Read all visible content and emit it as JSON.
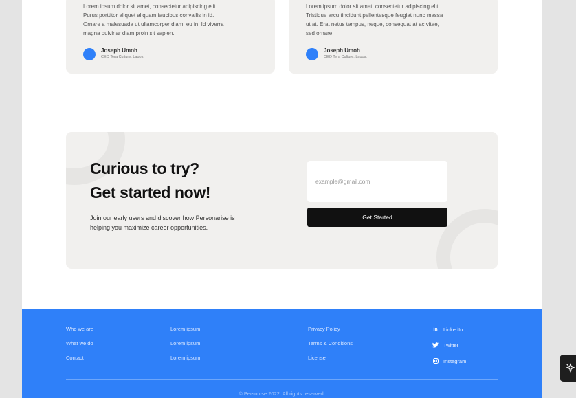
{
  "testimonials": [
    {
      "lines": [
        "Lorem ipsum dolor sit amet, consectetur adipiscing elit.",
        "Purus porttitor aliquet aliquam faucibus convallis in id.",
        "Ornare a malesuada ut ullamcorper diam, eu in. Id viverra",
        "magna pulvinar diam proin sit sapien."
      ],
      "name": "Joseph Umoh",
      "role": "CEO Tera Culture, Lagos."
    },
    {
      "lines": [
        "Lorem ipsum dolor sit amet, consectetur adipiscing elit.",
        "Tristique arcu tincidunt pellentesque feugiat nunc massa",
        "ut at. Erat netus tempus, neque, consequat at ac vitae,",
        "sed ornare."
      ],
      "name": "Joseph Umoh",
      "role": "CEO Tera Culture, Lagos."
    }
  ],
  "cta": {
    "heading_line1": "Curious to try?",
    "heading_line2": "Get started now!",
    "description_line1": "Join our early users and discover how Personarise is",
    "description_line2": "helping you maximize career opportunities.",
    "email_placeholder": "example@gmail.com",
    "button_label": "Get Started"
  },
  "footer": {
    "col1": [
      "Who we are",
      "What we do",
      "Contact"
    ],
    "col2": [
      "Lorem ipsum",
      "Lorem ipsum",
      "Lorem ipsum"
    ],
    "col3": [
      "Privacy Policy",
      "Terms & Conditions",
      "License"
    ],
    "social": [
      {
        "label": "LinkedIn",
        "icon": "linkedin-icon"
      },
      {
        "label": "Twitter",
        "icon": "twitter-icon"
      },
      {
        "label": "Instagram",
        "icon": "instagram-icon"
      }
    ],
    "copyright": "© Personise 2022. All rights reserved."
  },
  "colors": {
    "brand_blue": "#2f80f9",
    "card_bg": "#f1f0ee",
    "button_dark": "#111111"
  },
  "floating_button": {
    "icon": "sparkle-icon"
  }
}
